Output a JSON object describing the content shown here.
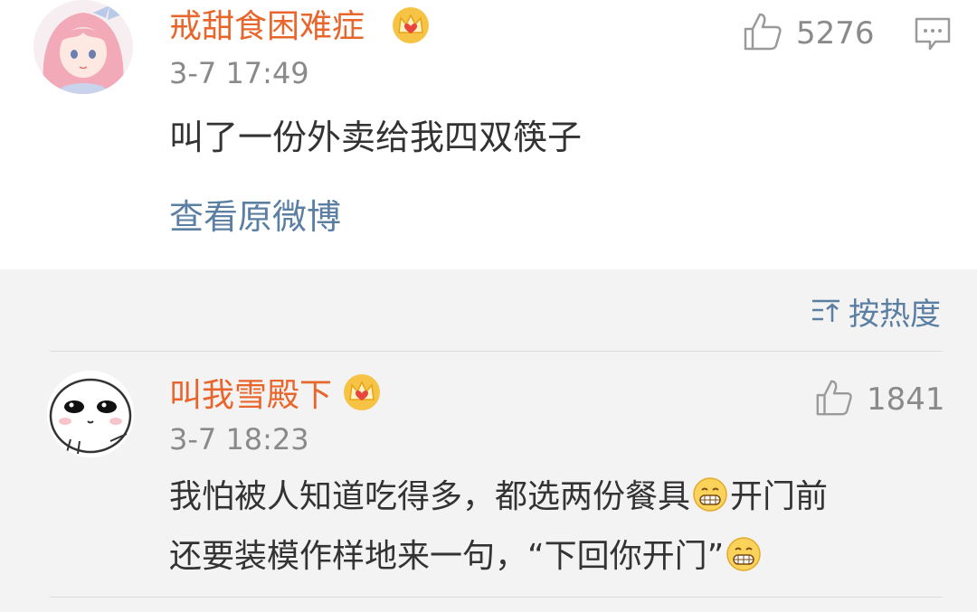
{
  "post": {
    "username": "戒甜食困难症",
    "time": "3-7 17:49",
    "text": "叫了一份外卖给我四双筷子",
    "view_original": "查看原微博",
    "likes": "5276",
    "badge_icon": "crown-icon",
    "avatar": "anime-girl-avatar",
    "colors": {
      "username": "#e8662c",
      "link": "#5b7ea3",
      "meta": "#8a8a8a"
    }
  },
  "sort": {
    "label": "按热度",
    "icon": "sort-icon"
  },
  "comments": [
    {
      "username": "叫我雪殿下",
      "time": "3-7 18:23",
      "likes": "1841",
      "lines": [
        {
          "before": "我怕被人知道吃得多，都选两份餐具",
          "after": "开门前"
        },
        {
          "before": "还要装模作样地来一句，“下回你开门”",
          "after": ""
        }
      ],
      "emoji": "grinning-face-icon",
      "avatar": "cartoon-face-avatar"
    }
  ]
}
